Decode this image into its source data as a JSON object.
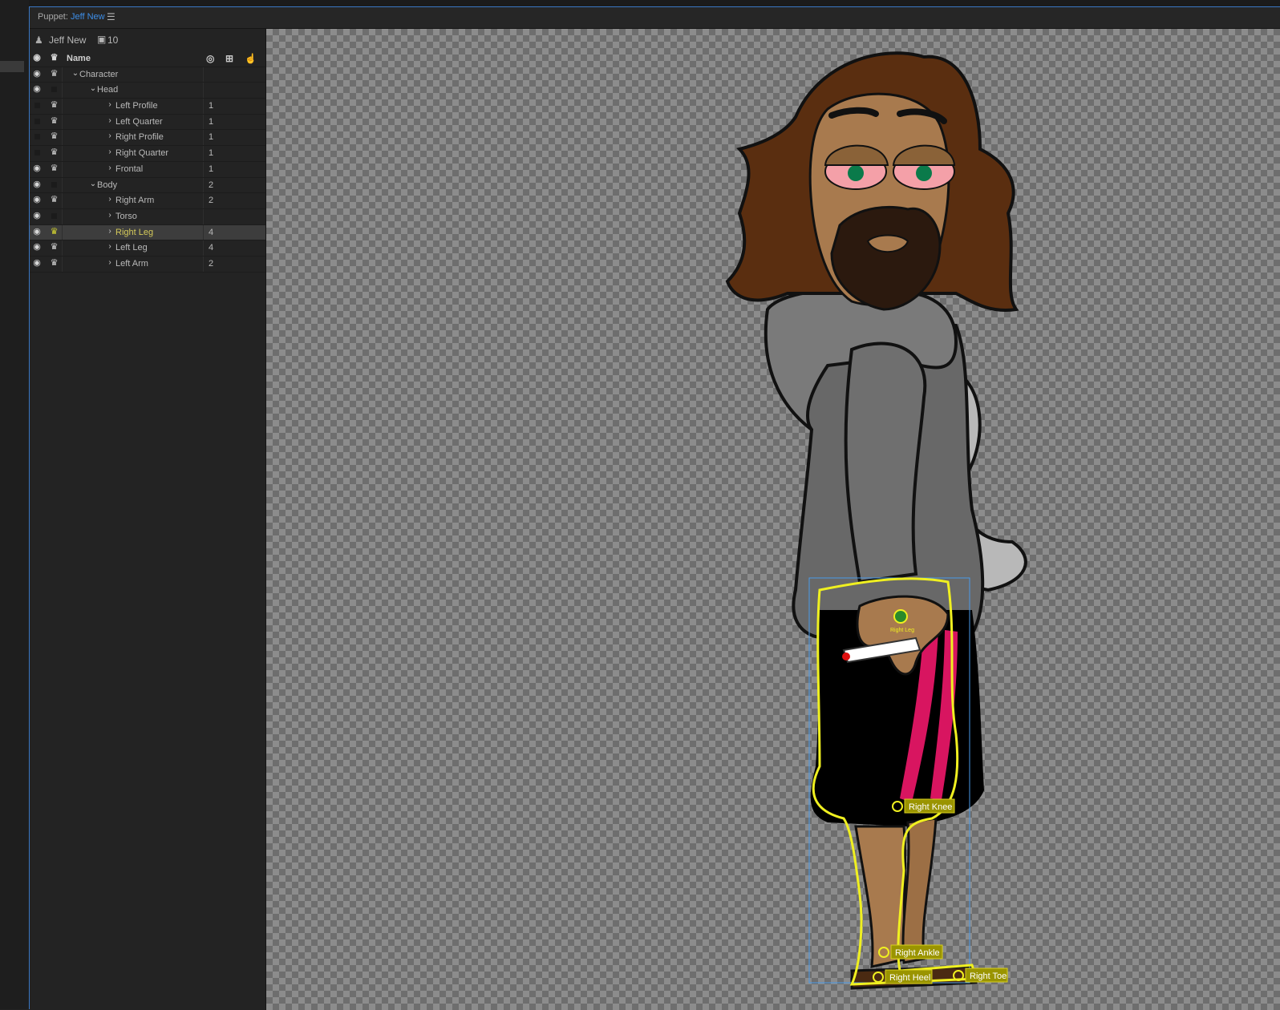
{
  "panel": {
    "title_prefix": "Puppet:",
    "title_name": "Jeff New",
    "menu_icon": "hamburger-menu-icon"
  },
  "puppet": {
    "name": "Jeff New",
    "count": "10",
    "icon": "person-icon",
    "count_icon": "scene-count-icon"
  },
  "tree": {
    "header": {
      "name_label": "Name",
      "icons": [
        "origin-icon",
        "tag-icon",
        "handle-tool-icon"
      ]
    },
    "rows": [
      {
        "label": "Character",
        "num": "",
        "eye": true,
        "crown": true,
        "chevron": "down",
        "indent": 0,
        "selected": false
      },
      {
        "label": "Head",
        "num": "",
        "eye": true,
        "crown": false,
        "chevron": "down",
        "indent": 1,
        "selected": false
      },
      {
        "label": "Left Profile",
        "num": "1",
        "eye": false,
        "crown": true,
        "chevron": "right",
        "indent": 2,
        "selected": false
      },
      {
        "label": "Left Quarter",
        "num": "1",
        "eye": false,
        "crown": true,
        "chevron": "right",
        "indent": 2,
        "selected": false
      },
      {
        "label": "Right Profile",
        "num": "1",
        "eye": false,
        "crown": true,
        "chevron": "right",
        "indent": 2,
        "selected": false
      },
      {
        "label": "Right Quarter",
        "num": "1",
        "eye": false,
        "crown": true,
        "chevron": "right",
        "indent": 2,
        "selected": false
      },
      {
        "label": "Frontal",
        "num": "1",
        "eye": true,
        "crown": true,
        "chevron": "right",
        "indent": 2,
        "selected": false
      },
      {
        "label": "Body",
        "num": "2",
        "eye": true,
        "crown": false,
        "chevron": "down",
        "indent": 1,
        "selected": false
      },
      {
        "label": "Right Arm",
        "num": "2",
        "eye": true,
        "crown": true,
        "chevron": "right",
        "indent": 2,
        "selected": false
      },
      {
        "label": "Torso",
        "num": "",
        "eye": true,
        "crown": false,
        "chevron": "right",
        "indent": 2,
        "selected": false
      },
      {
        "label": "Right Leg",
        "num": "4",
        "eye": true,
        "crown": true,
        "chevron": "right",
        "indent": 2,
        "selected": true
      },
      {
        "label": "Left Leg",
        "num": "4",
        "eye": true,
        "crown": true,
        "chevron": "right",
        "indent": 2,
        "selected": false
      },
      {
        "label": "Left Arm",
        "num": "2",
        "eye": true,
        "crown": true,
        "chevron": "right",
        "indent": 2,
        "selected": false
      }
    ]
  },
  "handles": {
    "origin": "Right Leg",
    "knee": "Right Knee",
    "ankle": "Right Ankle",
    "heel": "Right Heel",
    "toe": "Right Toe"
  },
  "colors": {
    "accent": "#3d8ee8",
    "selection_outline": "#f0f020",
    "handle_tag": "#9a9400",
    "hair": "#5a2e10",
    "skin": "#a87a4e",
    "hoodie": "#6a6a6a",
    "shorts": "#000000",
    "stripe": "#d81560"
  }
}
